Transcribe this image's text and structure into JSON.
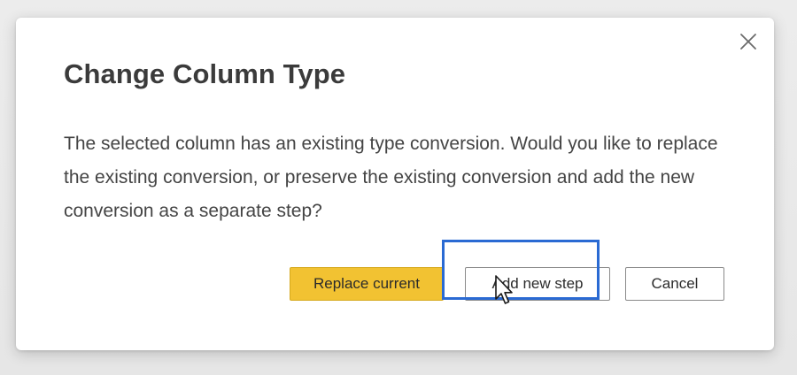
{
  "dialog": {
    "title": "Change Column Type",
    "message": "The selected column has an existing type conversion. Would you like to replace the existing conversion, or preserve the existing conversion and add the new conversion as a separate step?",
    "close_icon": "close-icon",
    "buttons": {
      "replace_label": "Replace current",
      "add_step_label": "Add new step",
      "cancel_label": "Cancel"
    },
    "focused_button": "add_step",
    "colors": {
      "primary_button": "#f2c232",
      "focus_ring": "#2a6ad3"
    }
  },
  "cursor": {
    "icon": "mouse-pointer-icon"
  }
}
